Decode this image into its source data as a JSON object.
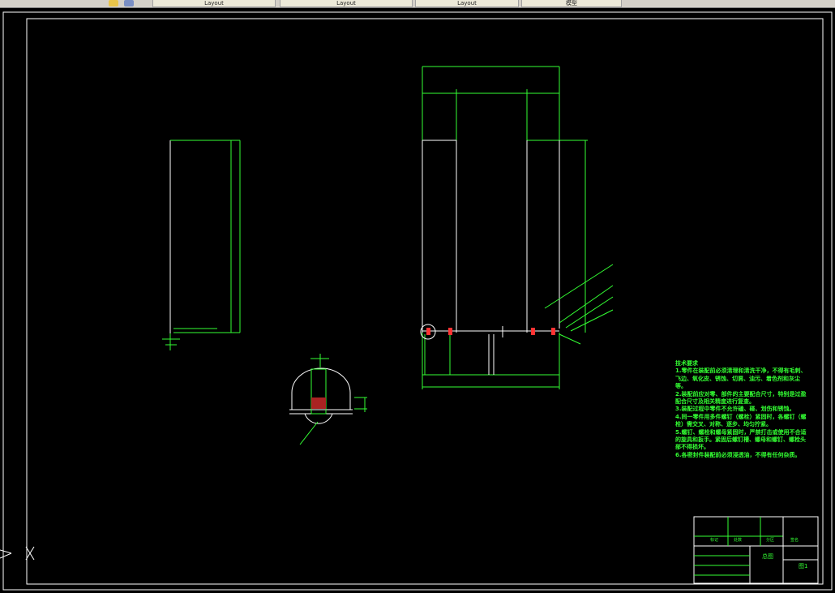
{
  "tabs": [
    {
      "label": "Layout"
    },
    {
      "label": "Layout"
    },
    {
      "label": "Layout"
    },
    {
      "label": "模型"
    }
  ],
  "notes": {
    "title": "技术要求",
    "lines": [
      "1.零件在装配前必须清理和清洗干净，不得有毛刺、飞边、氧化皮、锈蚀、切屑、油污、着色剂和灰尘等。",
      "2.装配前应对零、部件的主要配合尺寸，特别是过盈配合尺寸及相关精度进行复查。",
      "3.装配过程中零件不允许磕、碰、划伤和锈蚀。",
      "4.同一零件用多件螺钉（螺栓）紧固时，各螺钉（螺栓）需交叉、对称、逐步、均匀拧紧。",
      "5.螺钉、螺栓和螺母紧固时，严禁打击或使用不合适的旋具和扳手。紧固后螺钉槽、螺母和螺钉、螺栓头部不得损坏。",
      "6.各密封件装配前必须浸透油，不得有任何杂质。"
    ]
  },
  "title_block": {
    "part_name": "总图",
    "drawing_no": "图1",
    "col_labels": [
      "标记",
      "处数",
      "分区",
      "签名"
    ]
  },
  "colors": {
    "background": "#000000",
    "geometry": "#ffffff",
    "dimension": "#33ff33",
    "highlight": "#ff3333"
  },
  "icons": {
    "ucs": "ucs-axis-icon"
  }
}
